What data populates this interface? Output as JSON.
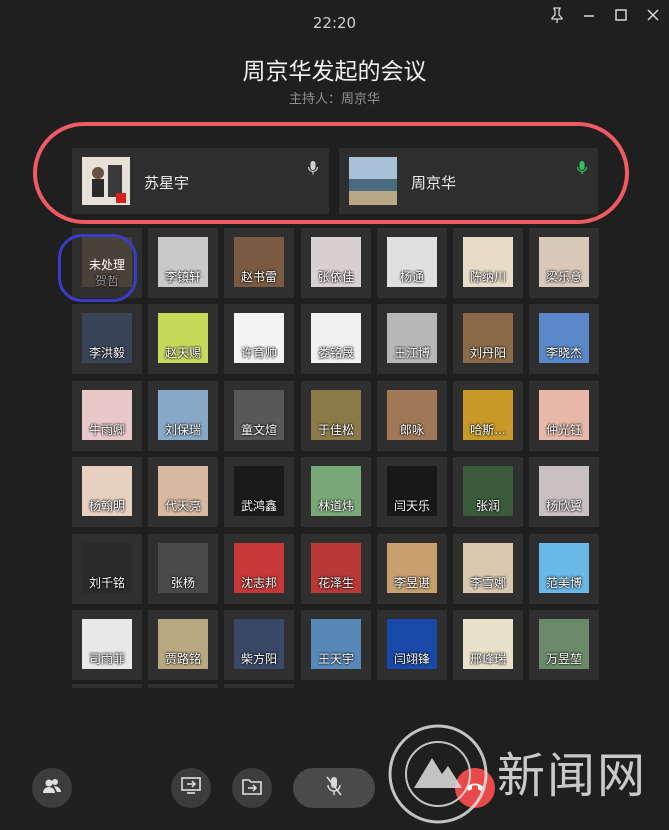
{
  "header": {
    "time": "22:20",
    "title": "周京华发起的会议",
    "host": "主持人：周京华"
  },
  "window_controls": [
    "pin-icon",
    "minimize-icon",
    "maximize-icon",
    "close-icon"
  ],
  "speakers": [
    {
      "name": "苏星宇",
      "mic_color": "#cfcfcf",
      "avatar": "person-photo"
    },
    {
      "name": "周京华",
      "mic_color": "#2fc25b",
      "avatar": "seascape-photo"
    }
  ],
  "participants": [
    {
      "name": "贺哲",
      "status": "未处理",
      "faded": true,
      "color": "#6b5a48"
    },
    {
      "name": "李镇轩",
      "color": "#c9c9c9"
    },
    {
      "name": "赵书雷",
      "color": "#7a5a40"
    },
    {
      "name": "张依佳",
      "color": "#d8d0d0"
    },
    {
      "name": "杨通",
      "color": "#e0e0e0"
    },
    {
      "name": "陈纳川",
      "color": "#e8dcc8"
    },
    {
      "name": "梁乐意",
      "color": "#d8c8b8"
    },
    {
      "name": "李洪毅",
      "color": "#3a4458"
    },
    {
      "name": "赵天赐",
      "color": "#c8d858"
    },
    {
      "name": "许育帅",
      "color": "#f4f4f4"
    },
    {
      "name": "娄铭晟",
      "color": "#f0f0f0"
    },
    {
      "name": "王江博",
      "color": "#b8b8b8"
    },
    {
      "name": "刘丹阳",
      "color": "#8a6a48"
    },
    {
      "name": "李晓杰",
      "color": "#5a88c8"
    },
    {
      "name": "牛雨卿",
      "color": "#e8c8c8"
    },
    {
      "name": "刘保瑞",
      "color": "#88a8c8"
    },
    {
      "name": "童文煊",
      "color": "#585858"
    },
    {
      "name": "于佳松",
      "color": "#8a7a48"
    },
    {
      "name": "郎咏",
      "color": "#a07858"
    },
    {
      "name": "哈斯...",
      "color": "#c89828"
    },
    {
      "name": "仲光钰",
      "color": "#e8b8a8"
    },
    {
      "name": "杨翰明",
      "color": "#e8d0c0"
    },
    {
      "name": "代天亮",
      "color": "#d8b8a0"
    },
    {
      "name": "武鸿鑫",
      "color": "#1a1a1a"
    },
    {
      "name": "林道炜",
      "color": "#78a878"
    },
    {
      "name": "闫天乐",
      "color": "#181818"
    },
    {
      "name": "张润",
      "color": "#3a5a3a"
    },
    {
      "name": "杨欣翼",
      "color": "#c8c0c0"
    },
    {
      "name": "刘千铭",
      "color": "#2a2a2a"
    },
    {
      "name": "张杨",
      "color": "#4a4a4a"
    },
    {
      "name": "沈志邦",
      "color": "#c83838"
    },
    {
      "name": "花泽生",
      "color": "#b83838"
    },
    {
      "name": "李昱谌",
      "color": "#c8a070"
    },
    {
      "name": "李雪娜",
      "color": "#d8c8b0"
    },
    {
      "name": "范美博",
      "color": "#68b8e8"
    },
    {
      "name": "司雨菲",
      "color": "#e8e8e8"
    },
    {
      "name": "贾路铭",
      "color": "#b8a880"
    },
    {
      "name": "柴方阳",
      "color": "#3a4868"
    },
    {
      "name": "王天宇",
      "color": "#5888b8"
    },
    {
      "name": "闫翊锋",
      "color": "#1848a8"
    },
    {
      "name": "邢峰瑞",
      "color": "#e8e0c8"
    },
    {
      "name": "万昱堃",
      "color": "#6a8a6a"
    }
  ],
  "toolbar": {
    "buttons": [
      "participants-icon",
      "share-screen-icon",
      "share-file-icon",
      "mic-muted-icon",
      "end-call-icon"
    ]
  },
  "watermark": {
    "text": "新闻网"
  },
  "annotations": {
    "red_ellipse_color": "#f05a64",
    "blue_ring_color": "#3a3cc4"
  }
}
